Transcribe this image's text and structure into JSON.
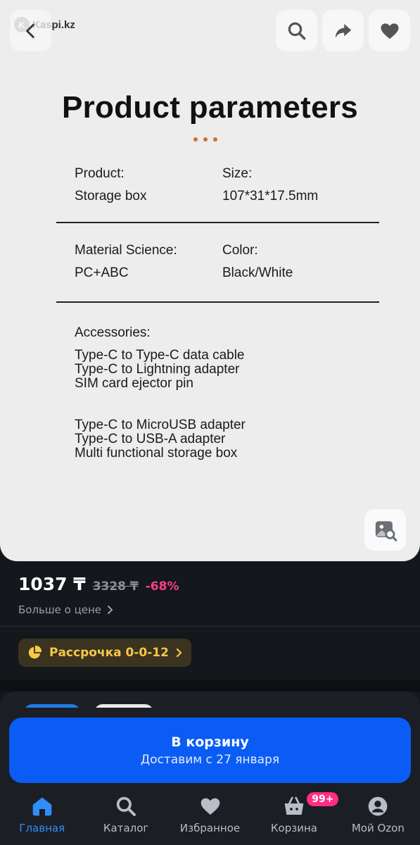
{
  "header": {
    "watermark": "Kaspi.kz",
    "watermark_initial": "K"
  },
  "product_image": {
    "title": "Product parameters",
    "params": [
      {
        "label": "Product:",
        "value": "Storage box"
      },
      {
        "label": "Size:",
        "value": "107*31*17.5mm"
      },
      {
        "label": "Material Science:",
        "value": "PC+ABC"
      },
      {
        "label": "Color:",
        "value": "Black/White"
      }
    ],
    "accessories_label": "Accessories:",
    "accessories": [
      "Type-C to Type-C data cable",
      "Type-C to Lightning adapter",
      "SIM card ejector pin",
      "Type-C to MicroUSB adapter",
      "Type-C to USB-A adapter",
      "Multi functional storage box"
    ]
  },
  "price": {
    "current": "1037 ₸",
    "old": "3328 ₸",
    "discount": "-68%",
    "more_link": "Больше о цене"
  },
  "installment": {
    "label": "Рассрочка 0-0-12"
  },
  "cart_button": {
    "title": "В корзину",
    "subtitle": "Доставим с 27 января"
  },
  "tabbar": {
    "items": [
      {
        "label": "Главная",
        "icon": "home-icon",
        "active": true
      },
      {
        "label": "Каталог",
        "icon": "search-icon",
        "active": false
      },
      {
        "label": "Избранное",
        "icon": "heart-icon",
        "active": false
      },
      {
        "label": "Корзина",
        "icon": "basket-icon",
        "active": false,
        "badge": "99+"
      },
      {
        "label": "Мой Ozon",
        "icon": "profile-icon",
        "active": false
      }
    ]
  },
  "colors": {
    "accent_blue": "#0a5cf5",
    "active_tab": "#2f8df8",
    "discount_pink": "#ff3d8b",
    "installment_yellow": "#f5c84a",
    "badge_pink": "#ff2e83"
  }
}
